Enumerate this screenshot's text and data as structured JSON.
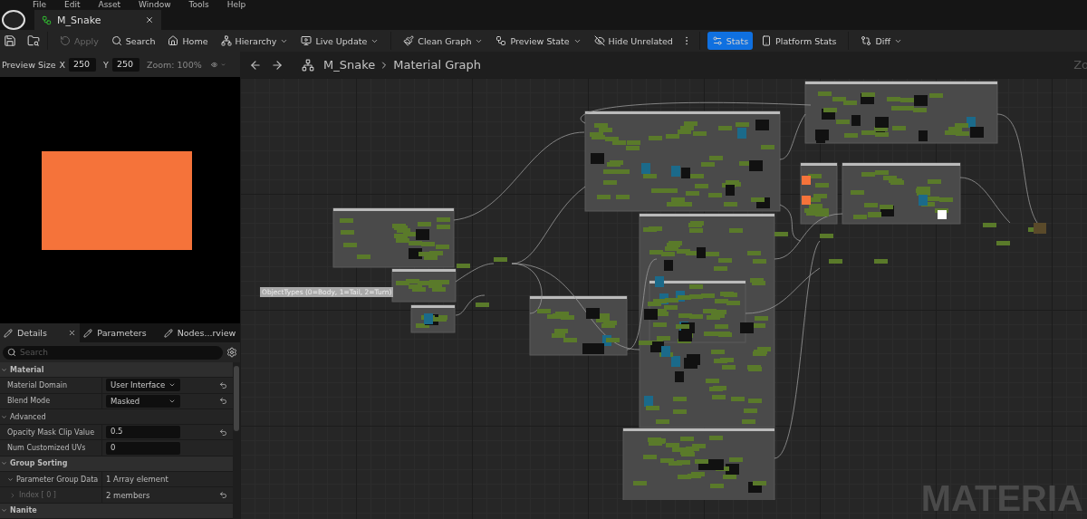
{
  "menu": [
    "File",
    "Edit",
    "Asset",
    "Window",
    "Tools",
    "Help"
  ],
  "document_tab": {
    "title": "M_Snake"
  },
  "toolbar": [
    {
      "label": "Apply",
      "dropdown": false,
      "disabled": true,
      "selected": false
    },
    {
      "label": "Search",
      "dropdown": false,
      "disabled": false,
      "selected": false
    },
    {
      "label": "Home",
      "dropdown": false,
      "disabled": false,
      "selected": false
    },
    {
      "label": "Hierarchy",
      "dropdown": true,
      "disabled": false,
      "selected": false
    },
    {
      "label": "Live Update",
      "dropdown": true,
      "disabled": false,
      "selected": false
    },
    {
      "label": "Clean Graph",
      "dropdown": true,
      "disabled": false,
      "selected": false
    },
    {
      "label": "Preview State",
      "dropdown": true,
      "disabled": false,
      "selected": false
    },
    {
      "label": "Hide Unrelated",
      "dropdown": false,
      "disabled": false,
      "selected": false
    },
    {
      "label": "Stats",
      "dropdown": false,
      "disabled": false,
      "selected": true
    },
    {
      "label": "Platform Stats",
      "dropdown": false,
      "disabled": false,
      "selected": false
    },
    {
      "label": "Diff",
      "dropdown": true,
      "disabled": false,
      "selected": false
    }
  ],
  "preview": {
    "size_label": "Preview Size",
    "x_label": "X",
    "x_value": "250",
    "y_label": "Y",
    "y_value": "250",
    "zoom": "Zoom: 100%"
  },
  "panel_tabs": [
    {
      "label": "Details",
      "selected": true
    },
    {
      "label": "Parameters",
      "selected": false
    },
    {
      "label": "Nodes...rview",
      "selected": false
    }
  ],
  "details_search": {
    "placeholder": "Search"
  },
  "details": [
    {
      "kind": "section",
      "label": "Material"
    },
    {
      "kind": "dropdown",
      "label": "Material Domain",
      "value": "User Interface",
      "resettable": true
    },
    {
      "kind": "dropdown",
      "label": "Blend Mode",
      "value": "Masked",
      "resettable": true
    },
    {
      "kind": "subsection",
      "label": "Advanced"
    },
    {
      "kind": "field",
      "label": "Opacity Mask Clip Value",
      "value": "0.5",
      "resettable": true
    },
    {
      "kind": "field",
      "label": "Num Customized UVs",
      "value": "0",
      "resettable": false
    },
    {
      "kind": "section",
      "label": "Group Sorting"
    },
    {
      "kind": "text",
      "label": "Parameter Group Data",
      "value": "1 Array element",
      "resettable": false
    },
    {
      "kind": "item",
      "label": "Index [ 0 ]",
      "value": "2 members",
      "resettable": true
    },
    {
      "kind": "section",
      "label": "Nanite"
    }
  ],
  "graph": {
    "breadcrumb": [
      "M_Snake",
      "Material Graph"
    ],
    "zoom_corner": "Zo",
    "comment": "ObjectTypes (0=Body, 1=Tail, 2=Turn)",
    "watermark": "MATERIA"
  }
}
